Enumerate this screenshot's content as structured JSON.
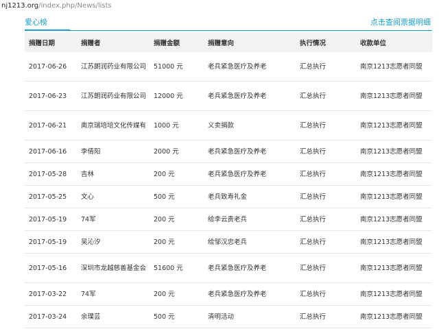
{
  "url": {
    "domain": "nj1213.org",
    "path": "/index.php/News/lists"
  },
  "header": {
    "tab_label": "爱心榜",
    "detail_link": "点击查阅票据明细"
  },
  "table": {
    "columns": [
      "捐赠日期",
      "捐赠者",
      "捐赠金额",
      "捐赠意向",
      "执行情况",
      "收款单位"
    ],
    "rows": [
      {
        "date": "2017-06-26",
        "donor": "江苏朗润药业有限公司",
        "amount": "51000 元",
        "purpose": "老兵紧急医疗及养老",
        "status": "汇总执行",
        "unit": "南京1213志愿者同盟"
      },
      {
        "date": "2017-06-23",
        "donor": "江苏朗润药业有限公司",
        "amount": "12000 元",
        "purpose": "老兵紧急医疗及养老",
        "status": "汇总执行",
        "unit": "南京1213志愿者同盟"
      },
      {
        "date": "2017-06-21",
        "donor": "南京瑞培培文化传媒有",
        "amount": "1000 元",
        "purpose": "义卖捐款",
        "status": "汇总执行",
        "unit": "南京1213志愿者同盟"
      },
      {
        "date": "2017-06-16",
        "donor": "李倩阳",
        "amount": "2000 元",
        "purpose": "老兵紧急医疗及养老",
        "status": "汇总执行",
        "unit": "南京1213志愿者同盟"
      },
      {
        "date": "2017-05-28",
        "donor": "吉林",
        "amount": "200 元",
        "purpose": "老兵紧急医疗及养老",
        "status": "汇总执行",
        "unit": "南京1213志愿者同盟"
      },
      {
        "date": "2017-05-25",
        "donor": "文心",
        "amount": "500 元",
        "purpose": "老兵致寿礼金",
        "status": "汇总执行",
        "unit": "南京1213志愿者同盟"
      },
      {
        "date": "2017-05-19",
        "donor": "74军",
        "amount": "200 元",
        "purpose": "给李云贵老兵",
        "status": "汇总执行",
        "unit": "南京1213志愿者同盟"
      },
      {
        "date": "2017-05-19",
        "donor": "吴沁汐",
        "amount": "200 元",
        "purpose": "给邹汉忠老兵",
        "status": "汇总执行",
        "unit": "南京1213志愿者同盟"
      },
      {
        "date": "2017-05-16",
        "donor": "深圳市龙越慈善基金会",
        "amount": "51600 元",
        "purpose": "老兵紧急医疗及养老",
        "status": "汇总执行",
        "unit": "南京1213志愿者同盟"
      },
      {
        "date": "2017-03-22",
        "donor": "74军",
        "amount": "200 元",
        "purpose": "老兵紧急医疗及养老",
        "status": "汇总执行",
        "unit": "南京1213志愿者同盟"
      },
      {
        "date": "2017-03-24",
        "donor": "余璞芸",
        "amount": "500 元",
        "purpose": "清明活动",
        "status": "汇总执行",
        "unit": "南京1213志愿者同盟"
      }
    ]
  }
}
